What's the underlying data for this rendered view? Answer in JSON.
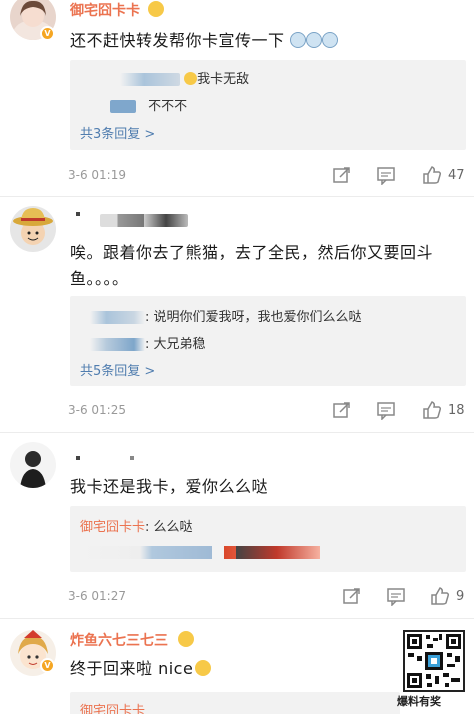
{
  "comments": [
    {
      "username": "御宅囧卡卡",
      "text": "还不赶快转发帮你卡宣传一下",
      "replies": [
        {
          "text": "我卡无敌"
        },
        {
          "text": "不不不"
        }
      ],
      "more_replies": "共3条回复 >",
      "time": "3-6 01:19",
      "likes": "47"
    },
    {
      "text_line1": "唉。跟着你去了熊猫，去了全民，然后你又要回斗",
      "text_line2": "鱼。。。。",
      "replies": [
        {
          "text": ": 说明你们爱我呀，我也爱你们么么哒"
        },
        {
          "text": ": 大兄弟稳"
        }
      ],
      "more_replies": "共5条回复 >",
      "time": "3-6 01:25",
      "likes": "18"
    },
    {
      "text": "我卡还是我卡，爱你么么哒",
      "replies": [
        {
          "name": "御宅囧卡卡",
          "text": ": 么么哒"
        }
      ],
      "time": "3-6 01:27",
      "likes": "9"
    },
    {
      "username": "炸鱼六七三七三",
      "text": "终于回来啦 nice",
      "replies": [
        {
          "name": "御宅囧卡卡"
        }
      ]
    }
  ],
  "watermark": "爆料有奖",
  "colors": {
    "accent_name": "#eb7350",
    "link": "#507daf",
    "reply_bg": "#f2f2f2",
    "vip_badge": "#f5a623"
  },
  "icons": [
    "share-icon",
    "comment-icon",
    "like-icon",
    "vip-badge-icon",
    "qr-code"
  ]
}
